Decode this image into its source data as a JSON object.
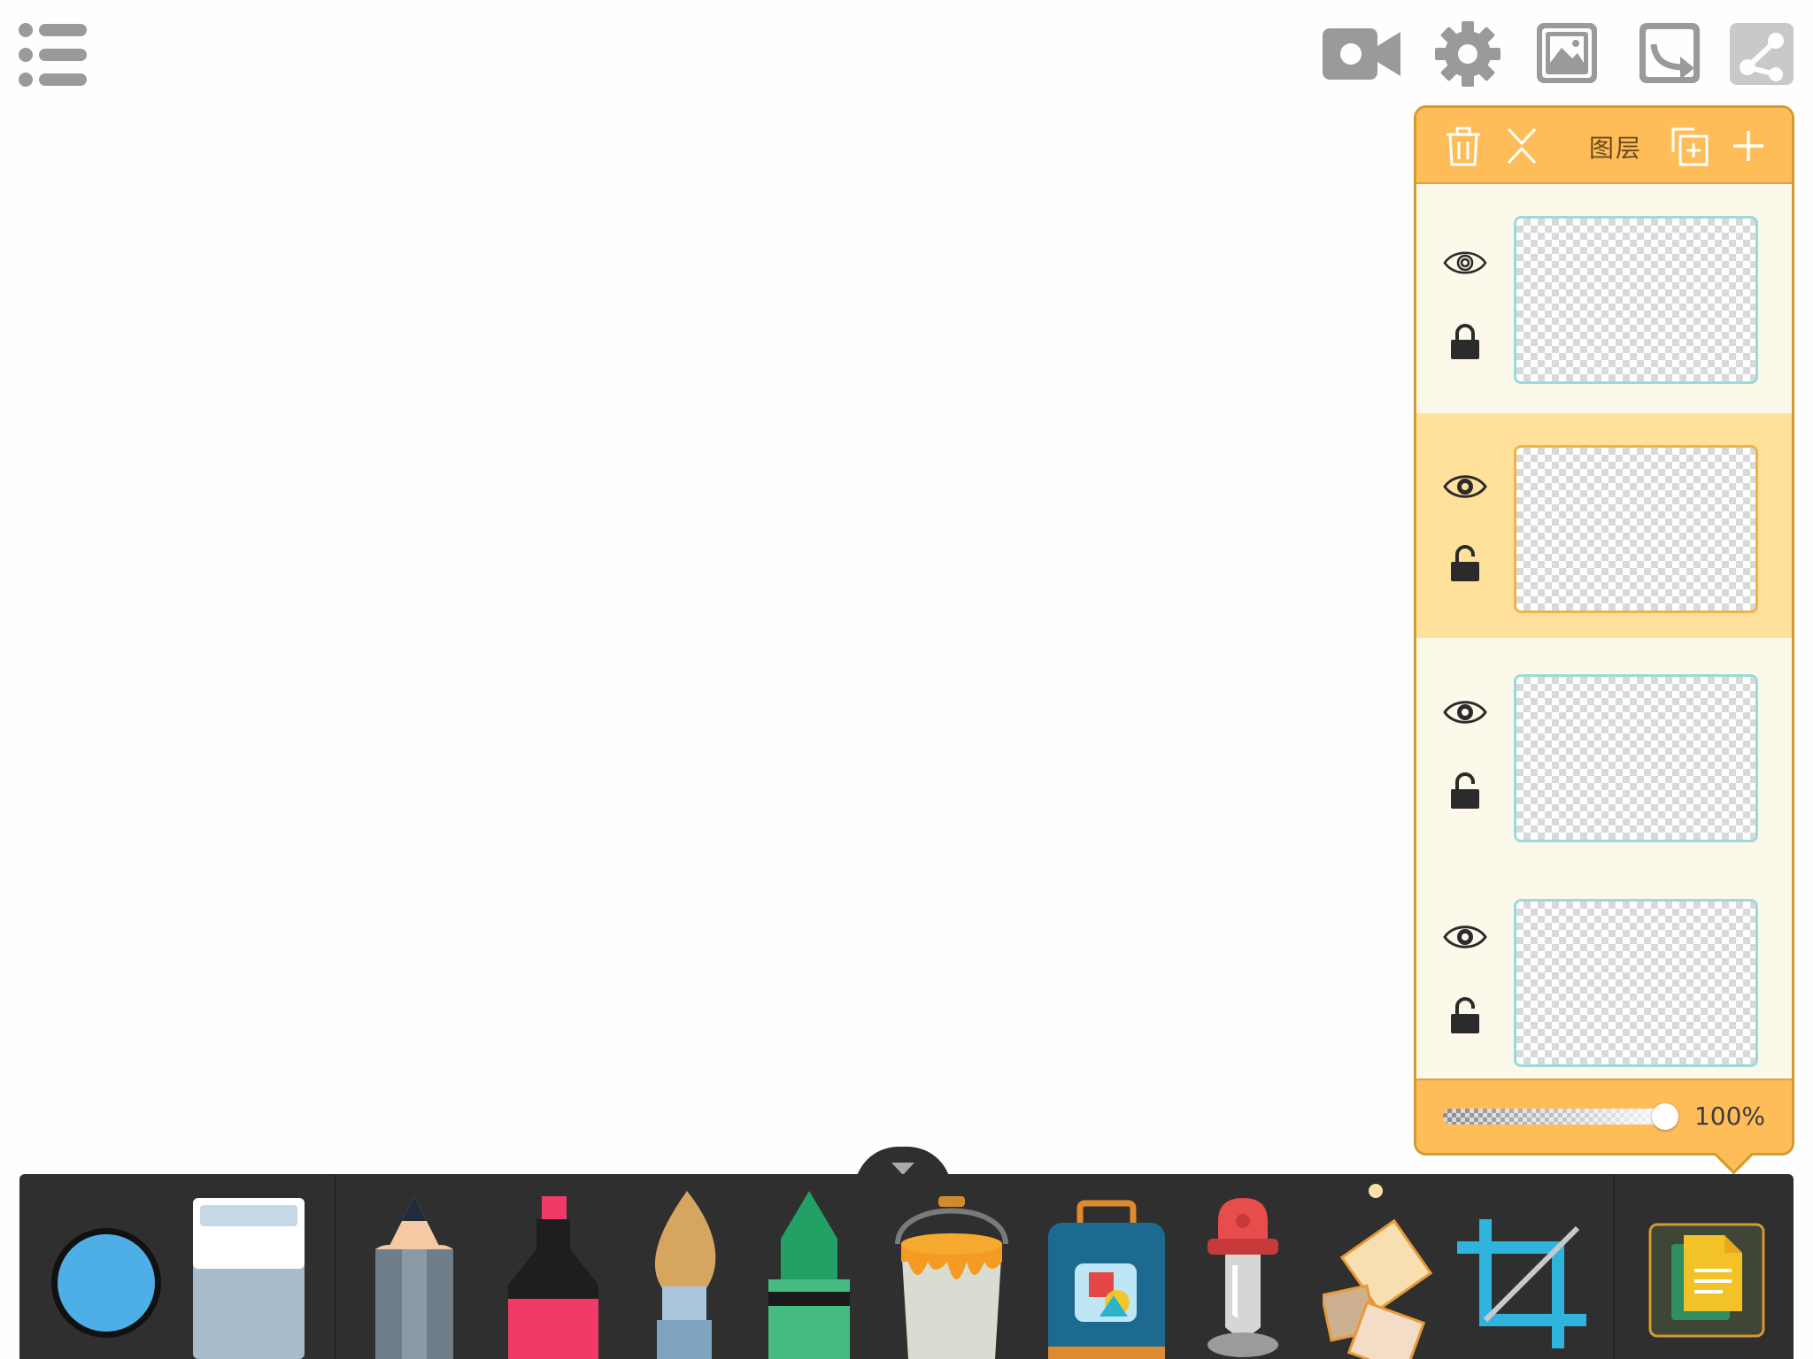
{
  "toolbar_top": {
    "menu_icon": "list-menu-icon",
    "icons": [
      "video-camera-icon",
      "gear-icon",
      "gallery-icon",
      "export-icon",
      "share-icon"
    ]
  },
  "layers_panel": {
    "title": "图层",
    "header_icons": [
      "trash-icon",
      "merge-icon",
      "duplicate-icon",
      "plus-icon"
    ],
    "layers": [
      {
        "visible": true,
        "locked": true,
        "selected": false
      },
      {
        "visible": true,
        "locked": false,
        "selected": true
      },
      {
        "visible": true,
        "locked": false,
        "selected": false
      },
      {
        "visible": true,
        "locked": false,
        "selected": false
      }
    ],
    "opacity": "100%"
  },
  "bottom_toolbar": {
    "color_swatch": "#4eaee6",
    "tools": [
      "eraser",
      "pencil",
      "marker",
      "paintbrush",
      "crayon",
      "paint-bucket",
      "sticker-bag",
      "stamp",
      "pattern-tiles",
      "crop",
      "layers-page"
    ]
  }
}
